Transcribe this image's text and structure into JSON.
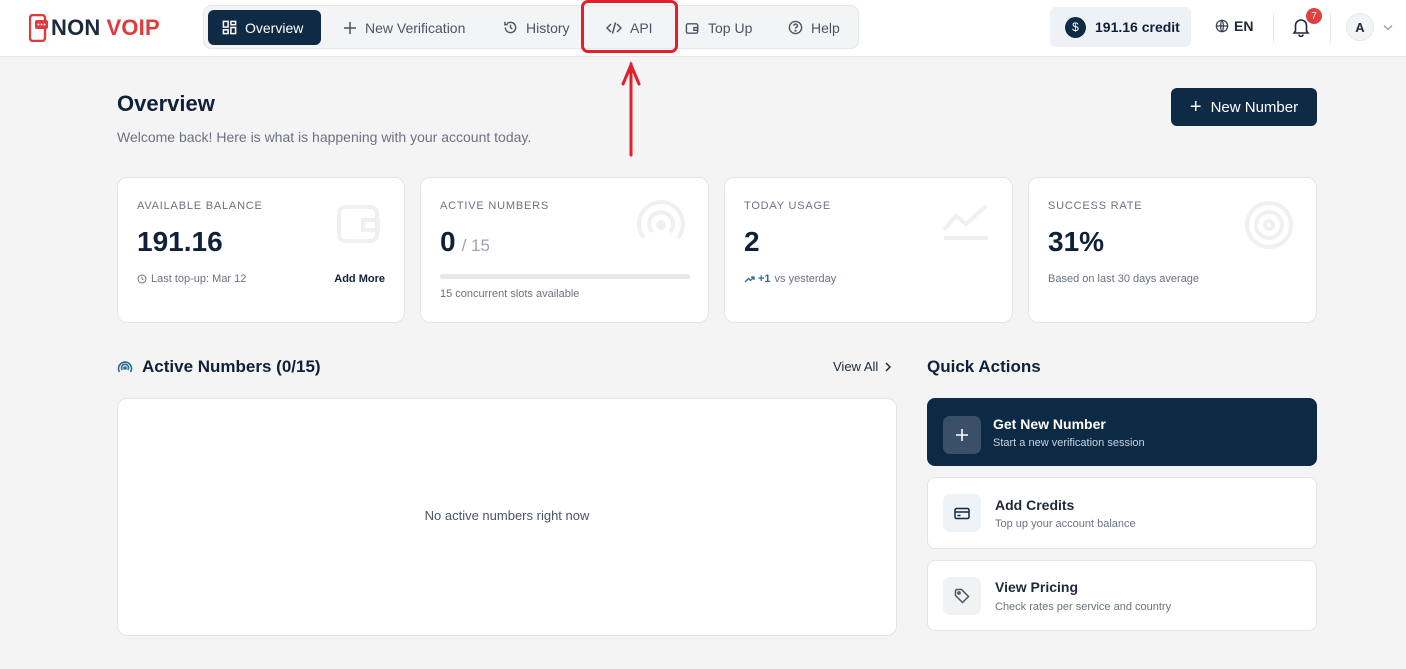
{
  "brand": {
    "word1": "NON",
    "word2": "VOIP"
  },
  "nav": {
    "items": [
      {
        "label": "Overview"
      },
      {
        "label": "New Verification"
      },
      {
        "label": "History"
      },
      {
        "label": "API"
      },
      {
        "label": "Top Up"
      },
      {
        "label": "Help"
      }
    ]
  },
  "header": {
    "credit_symbol": "$",
    "credit_label": "191.16 credit",
    "language": "EN",
    "notification_count": "7",
    "avatar_initial": "A"
  },
  "page": {
    "title": "Overview",
    "subtitle": "Welcome back! Here is what is happening with your account today.",
    "new_number_button": "New Number"
  },
  "stats": {
    "balance": {
      "label": "AVAILABLE BALANCE",
      "value": "191.16",
      "footnote": "Last top-up: Mar 12",
      "link": "Add More"
    },
    "active": {
      "label": "ACTIVE NUMBERS",
      "value": "0",
      "of": "/ 15",
      "progress_fraction": 0,
      "footnote": "15 concurrent slots available"
    },
    "usage": {
      "label": "TODAY USAGE",
      "value": "2",
      "change": "+1",
      "footnote": "vs yesterday"
    },
    "success": {
      "label": "SUCCESS RATE",
      "value": "31%",
      "footnote": "Based on last 30 days average"
    }
  },
  "active_numbers": {
    "title": "Active Numbers (0/15)",
    "view_all": "View All",
    "empty": "No active numbers right now"
  },
  "quick_actions": {
    "title": "Quick Actions",
    "items": [
      {
        "title": "Get New Number",
        "subtitle": "Start a new verification session"
      },
      {
        "title": "Add Credits",
        "subtitle": "Top up your account balance"
      },
      {
        "title": "View Pricing",
        "subtitle": "Check rates per service and country"
      }
    ]
  },
  "colors": {
    "primary": "#0f2a44",
    "brand_red": "#e03a3a",
    "annotation": "#e0202a"
  }
}
